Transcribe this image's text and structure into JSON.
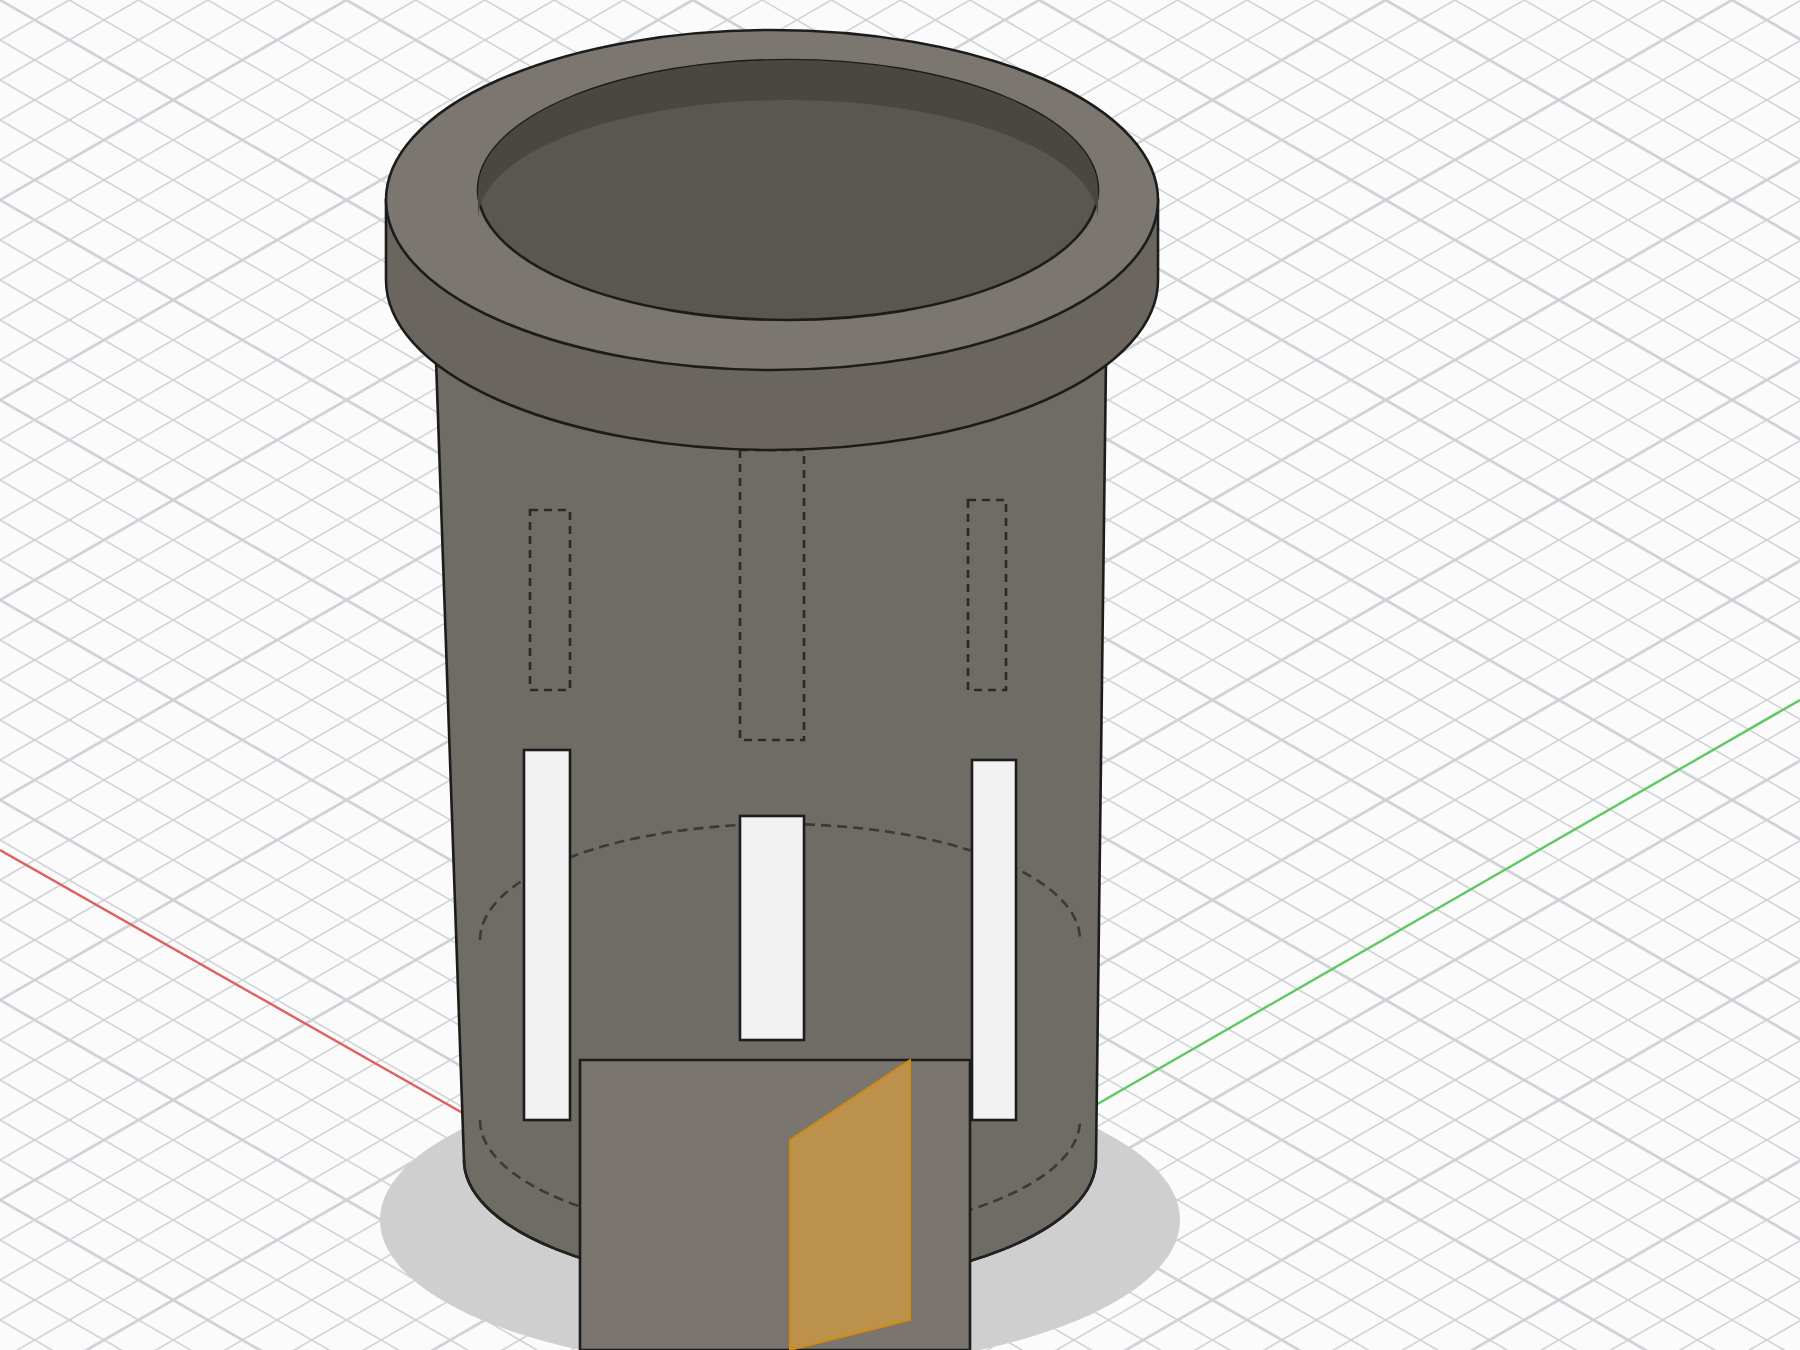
{
  "viewport": {
    "grid": true,
    "axes": true,
    "origin_plane": true
  }
}
